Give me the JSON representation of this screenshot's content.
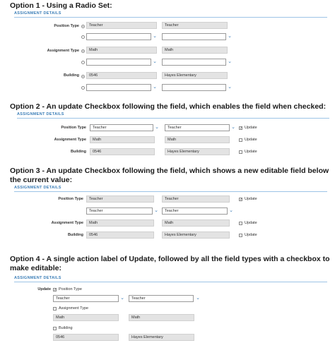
{
  "option1": {
    "heading": "Option 1 - Using a Radio Set:",
    "section": "ASSIGNMENT DETAILS",
    "position_label": "Position Type",
    "assignment_label": "Assignment Type",
    "building_label": "Building",
    "position_current": "Teacher",
    "position_readonly": "Teacher",
    "assignment_current": "Math",
    "assignment_readonly": "Math",
    "building_current": "0546",
    "building_readonly": "Hayes Elementary"
  },
  "option2": {
    "heading": "Option 2 - An update Checkbox following the field, which enables the field when checked:",
    "section": "ASSIGNMENT DETAILS",
    "position_label": "Position Type",
    "assignment_label": "Assignment Type",
    "building_label": "Building",
    "position_value": "Teacher",
    "position_select": "Teacher",
    "assignment_value": "Math",
    "assignment_readonly": "Math",
    "building_value": "0546",
    "building_readonly": "Hayes Elementary",
    "update_label": "Update"
  },
  "option3": {
    "heading_line1": "Option 3 - An update Checkbox following the field, which shows a new editable field below",
    "heading_line2": "the current value:",
    "section": "ASSIGNMENT DETAILS",
    "position_label": "Position Type",
    "assignment_label": "Assignment Type",
    "building_label": "Building",
    "position_value": "Teacher",
    "position_readonly": "Teacher",
    "new_position_value": "Teacher",
    "new_position_select": "Teacher",
    "assignment_value": "Math",
    "assignment_readonly": "Math",
    "building_value": "0546",
    "building_readonly": "Hayes Elementary",
    "update_label": "Update"
  },
  "option4": {
    "heading_line1": "Option 4 - A single action label of Update, followed by all the field types with a checkbox to",
    "heading_line2": "make editable:",
    "section": "ASSIGNMENT DETAILS",
    "update_label": "Update",
    "position_check_label": "Position Type",
    "position_value": "Teacher",
    "position_select": "Teacher",
    "assignment_check_label": "Assignment Type",
    "assignment_value": "Math",
    "assignment_readonly": "Math",
    "building_check_label": "Building",
    "building_value": "0546",
    "building_readonly": "Hayes Elementary"
  },
  "colors": {
    "accent": "#3d7fb8",
    "readonly_bg": "#e3e3e3",
    "section_line": "#9dc3e6"
  }
}
